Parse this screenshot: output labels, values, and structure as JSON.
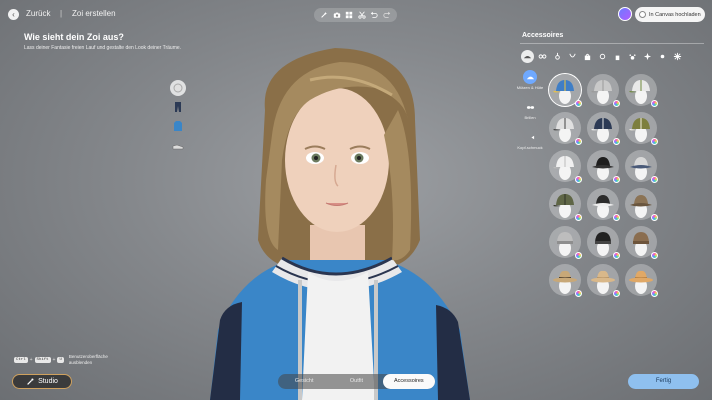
{
  "nav": {
    "back_label": "Zurück",
    "separator": "|",
    "breadcrumb": "Zoi erstellen"
  },
  "toolbar": {
    "icons": [
      "wand-icon",
      "camera-icon",
      "grid-icon",
      "scissors-icon",
      "undo-icon",
      "redo-icon"
    ]
  },
  "header_right": {
    "canvas_button_label": "In Canvas hochladen"
  },
  "intro": {
    "title": "Wie sieht dein Zoi aus?",
    "subtitle": "Lass deiner Fantasie freien Lauf und gestalte den Look deiner Träume."
  },
  "accessories": {
    "title": "Accessoires",
    "side_nav": [
      {
        "label": "Mützen & Hüte",
        "icon": "hat-icon",
        "active": true
      },
      {
        "label": "Brillen",
        "icon": "glasses-icon",
        "active": false
      },
      {
        "label": "Kopf-schmuck",
        "icon": "headpiece-icon",
        "active": false
      }
    ],
    "items": [
      {
        "name": "blue-cap",
        "color": "#3f7ec6",
        "accent": "#f0c43a",
        "style": "cap"
      },
      {
        "name": "grey-cap",
        "color": "#c9c9c9",
        "accent": "#9a9a9a",
        "style": "cap"
      },
      {
        "name": "green-white-cap",
        "color": "#e8e8e8",
        "accent": "#6f8a3c",
        "style": "cap"
      },
      {
        "name": "patterned-cap",
        "color": "#e0e0e0",
        "accent": "#444444",
        "style": "cap"
      },
      {
        "name": "navy-cap",
        "color": "#2c3a55",
        "accent": "#e8e8e8",
        "style": "cap"
      },
      {
        "name": "olive-cap",
        "color": "#7d7f3e",
        "accent": "#f2efe2",
        "style": "cap"
      },
      {
        "name": "light-cap",
        "color": "#f0f0f0",
        "accent": "#bbbbbb",
        "style": "cap"
      },
      {
        "name": "black-bucket-hat",
        "color": "#1e1e1e",
        "accent": "#333333",
        "style": "bucket"
      },
      {
        "name": "check-bucket-hat",
        "color": "#d8d8d8",
        "accent": "#4a5a78",
        "style": "bucket"
      },
      {
        "name": "camo-cap",
        "color": "#5f6646",
        "accent": "#2f3225",
        "style": "cap"
      },
      {
        "name": "floral-bucket-hat",
        "color": "#2b2b2b",
        "accent": "#eeeeee",
        "style": "bucket"
      },
      {
        "name": "beige-bucket-hat",
        "color": "#8b7355",
        "accent": "#6a563f",
        "style": "bucket"
      },
      {
        "name": "grey-beanie",
        "color": "#bdbdbd",
        "accent": "#8e8e8e",
        "style": "beanie"
      },
      {
        "name": "black-beanie",
        "color": "#222222",
        "accent": "#444444",
        "style": "beanie"
      },
      {
        "name": "brown-beanie",
        "color": "#8a6d4f",
        "accent": "#6d543b",
        "style": "beanie"
      },
      {
        "name": "straw-hat",
        "color": "#c8a878",
        "accent": "#3b2f22",
        "style": "fedora"
      },
      {
        "name": "tan-hat",
        "color": "#d9b88a",
        "accent": "#b39063",
        "style": "fedora"
      },
      {
        "name": "orange-hat",
        "color": "#e0a866",
        "accent": "#b07a3c",
        "style": "fedora"
      }
    ]
  },
  "bottom": {
    "kbd_keys": [
      "Ctrl",
      "Shift",
      "U"
    ],
    "kbd_hint": "Benutzeroberfläche ausblenden",
    "studio_label": "Studio",
    "tabs": [
      {
        "label": "Gesicht",
        "active": false
      },
      {
        "label": "Outfit",
        "active": false
      },
      {
        "label": "Accessoires",
        "active": true
      }
    ],
    "done_label": "Fertig"
  },
  "colors": {
    "accent_blue": "#8fc0ef",
    "studio_border": "#cfa15e",
    "jacket_blue": "#3a86c8",
    "jacket_navy": "#232d45"
  }
}
